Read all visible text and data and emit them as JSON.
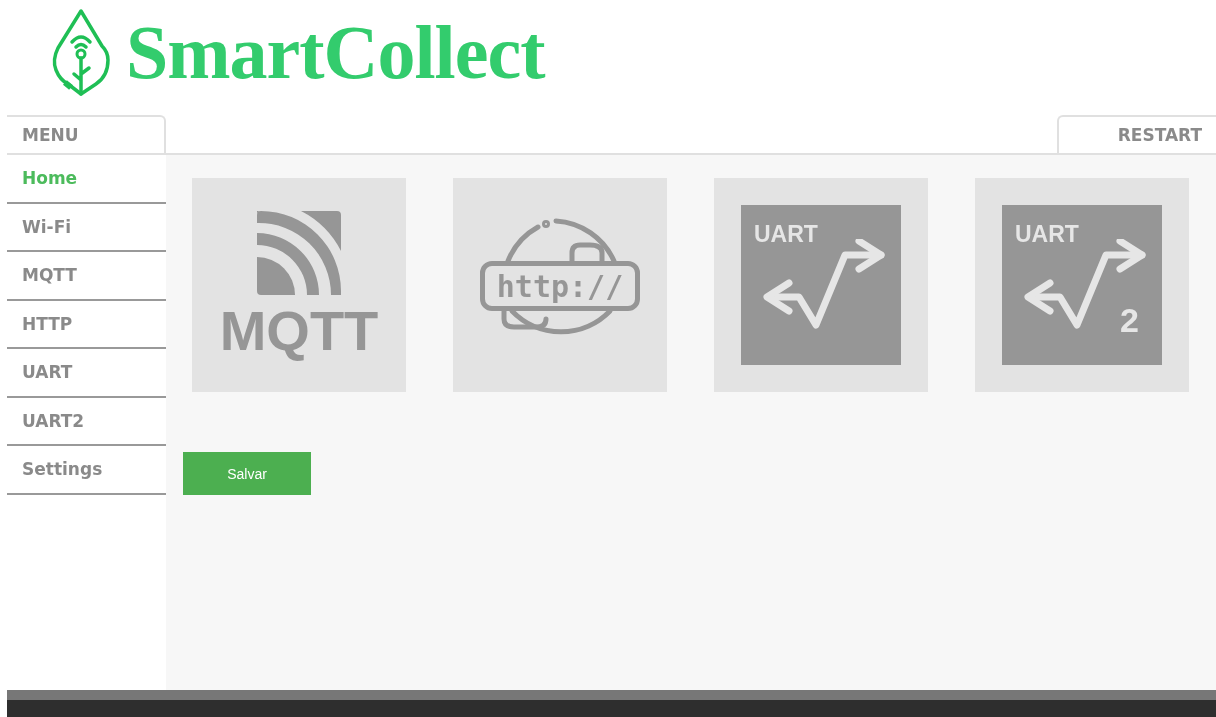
{
  "brand": {
    "title": "SmartCollect"
  },
  "menu_tab": {
    "label": "MENU"
  },
  "restart_tab": {
    "label": "RESTART"
  },
  "sidebar": {
    "items": [
      {
        "label": "Home",
        "selected": true
      },
      {
        "label": "Wi-Fi",
        "selected": false
      },
      {
        "label": "MQTT",
        "selected": false
      },
      {
        "label": "HTTP",
        "selected": false
      },
      {
        "label": "UART",
        "selected": false
      },
      {
        "label": "UART2",
        "selected": false
      },
      {
        "label": "Settings",
        "selected": false
      }
    ]
  },
  "tiles": [
    {
      "kind": "mqtt",
      "text": "MQTT"
    },
    {
      "kind": "http",
      "text": "http://"
    },
    {
      "kind": "uart",
      "text": "UART"
    },
    {
      "kind": "uart",
      "text": "UART",
      "sub": "2"
    }
  ],
  "save_button": {
    "label": "Salvar"
  }
}
